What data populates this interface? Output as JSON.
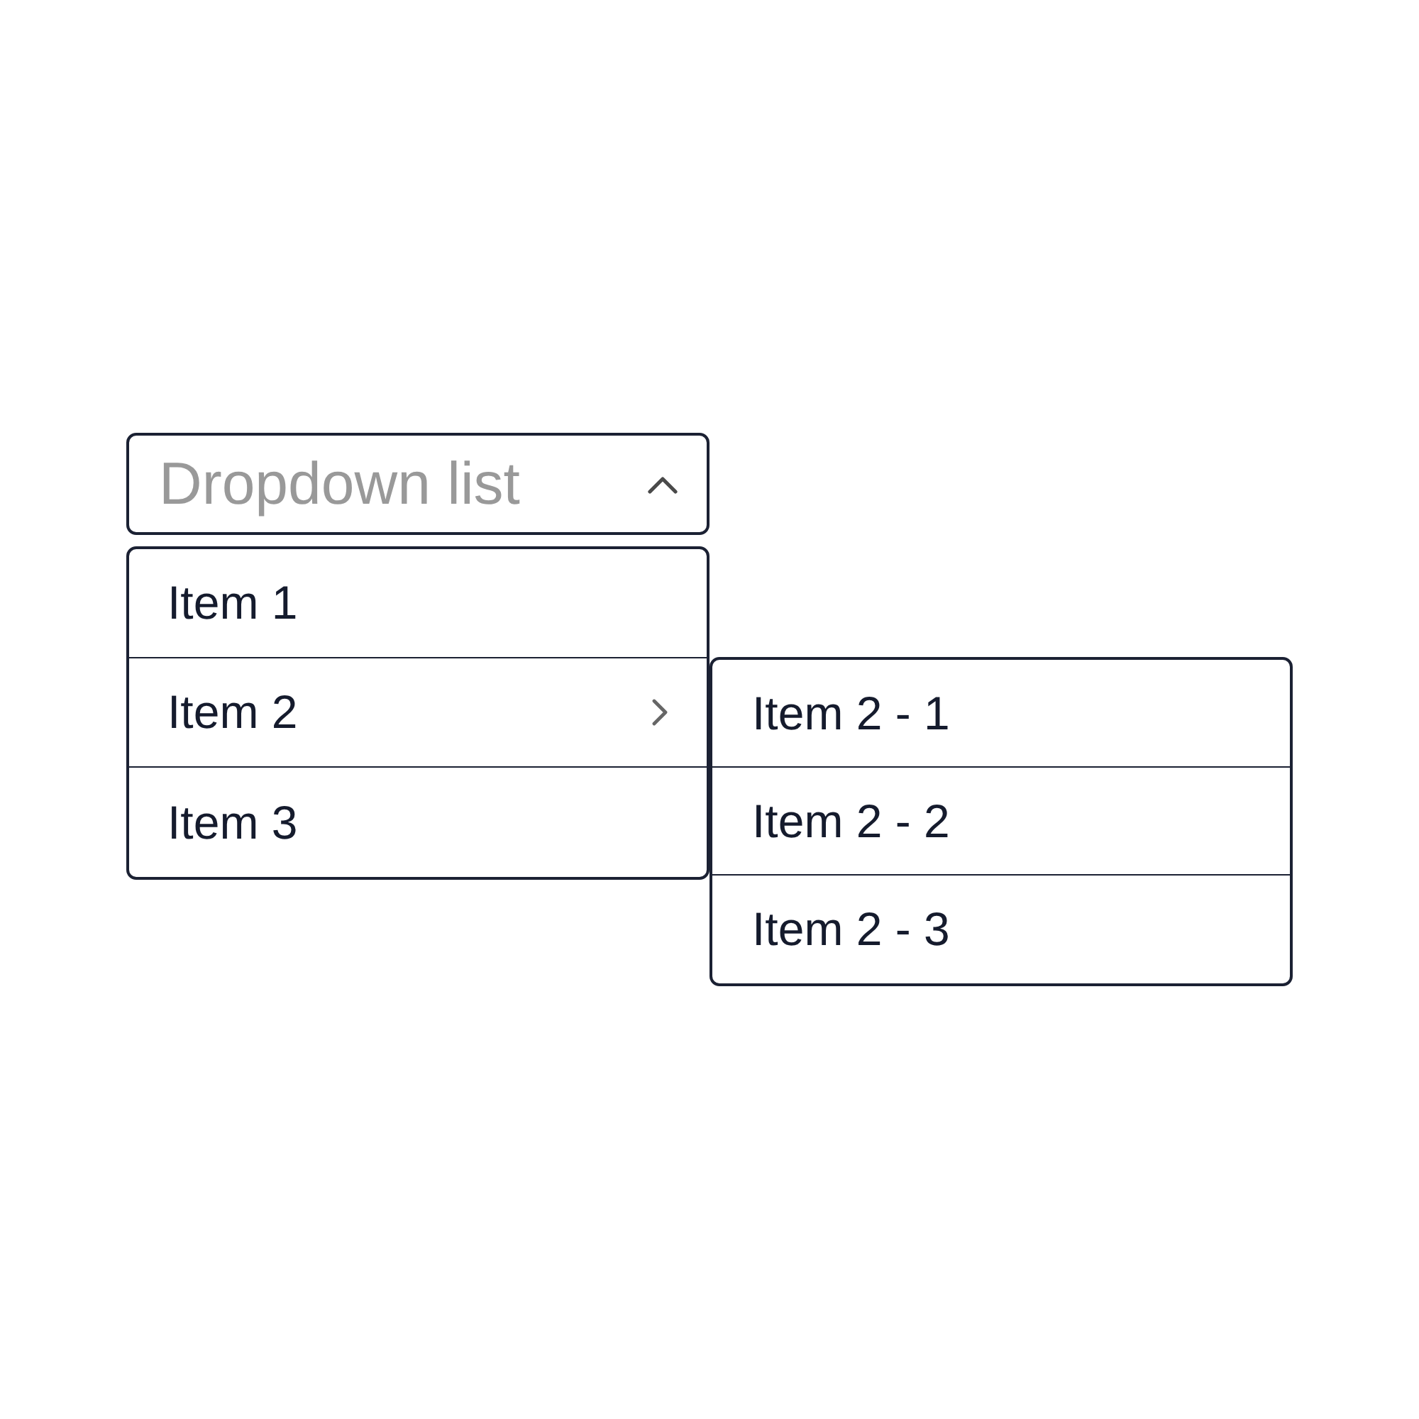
{
  "dropdown": {
    "placeholder": "Dropdown list",
    "expanded": true
  },
  "items": [
    {
      "label": "Item 1"
    },
    {
      "label": "Item 2",
      "expanded": true,
      "children": [
        {
          "label": "Item 2 - 1"
        },
        {
          "label": "Item 2 - 2"
        },
        {
          "label": "Item 2 - 3"
        }
      ]
    },
    {
      "label": "Item 3"
    }
  ]
}
